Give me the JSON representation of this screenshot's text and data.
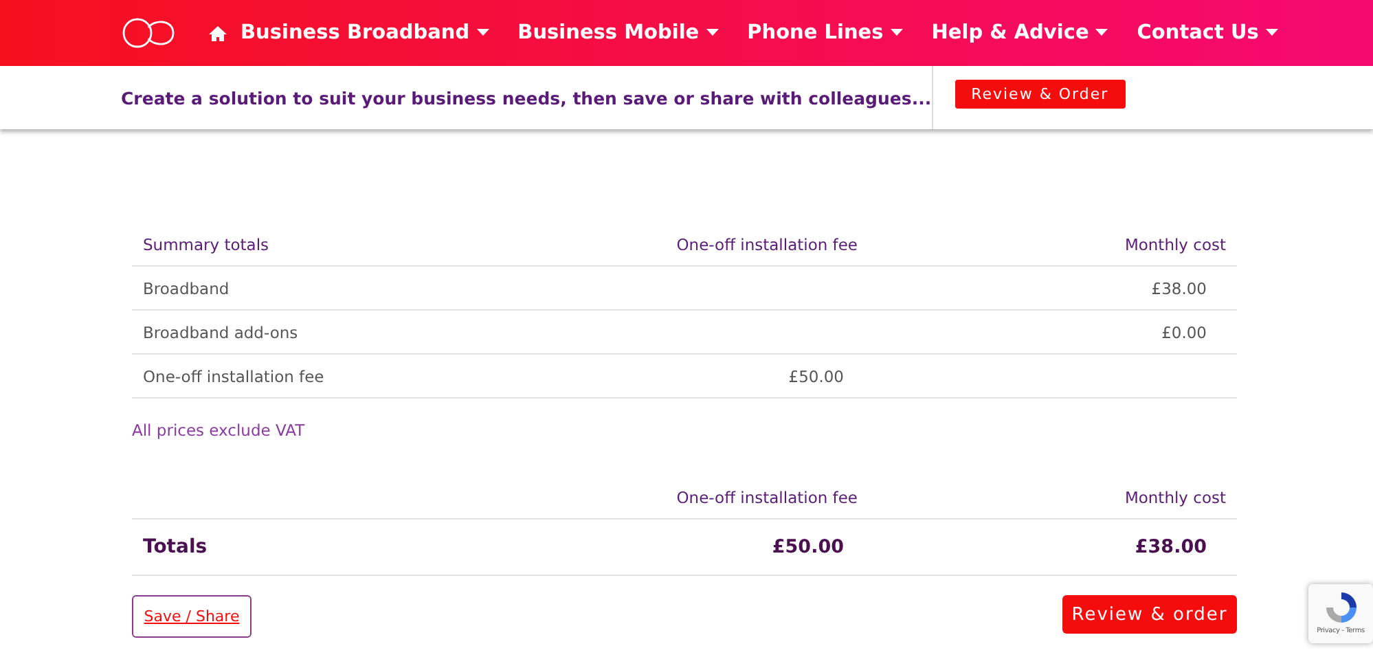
{
  "nav": {
    "items": [
      {
        "label": "Business Broadband"
      },
      {
        "label": "Business Mobile"
      },
      {
        "label": "Phone Lines"
      },
      {
        "label": "Help & Advice"
      },
      {
        "label": "Contact Us"
      }
    ]
  },
  "subbar": {
    "text": "Create a solution to suit your business needs, then save or share with colleagues...",
    "button": "Review & Order"
  },
  "summary": {
    "columns": [
      "Summary totals",
      "One-off installation fee",
      "Monthly cost"
    ],
    "rows": [
      {
        "label": "Broadband",
        "fee": "",
        "monthly": "£38.00"
      },
      {
        "label": "Broadband add-ons",
        "fee": "",
        "monthly": "£0.00"
      },
      {
        "label": "One-off installation fee",
        "fee": "£50.00",
        "monthly": ""
      }
    ]
  },
  "vat_note": "All prices exclude VAT",
  "totals": {
    "columns": [
      "One-off installation fee",
      "Monthly cost"
    ],
    "label": "Totals",
    "fee": "£50.00",
    "monthly": "£38.00"
  },
  "buttons": {
    "save": "Save / Share",
    "order": "Review & order"
  },
  "recaptcha": {
    "text": "Privacy - Terms"
  }
}
